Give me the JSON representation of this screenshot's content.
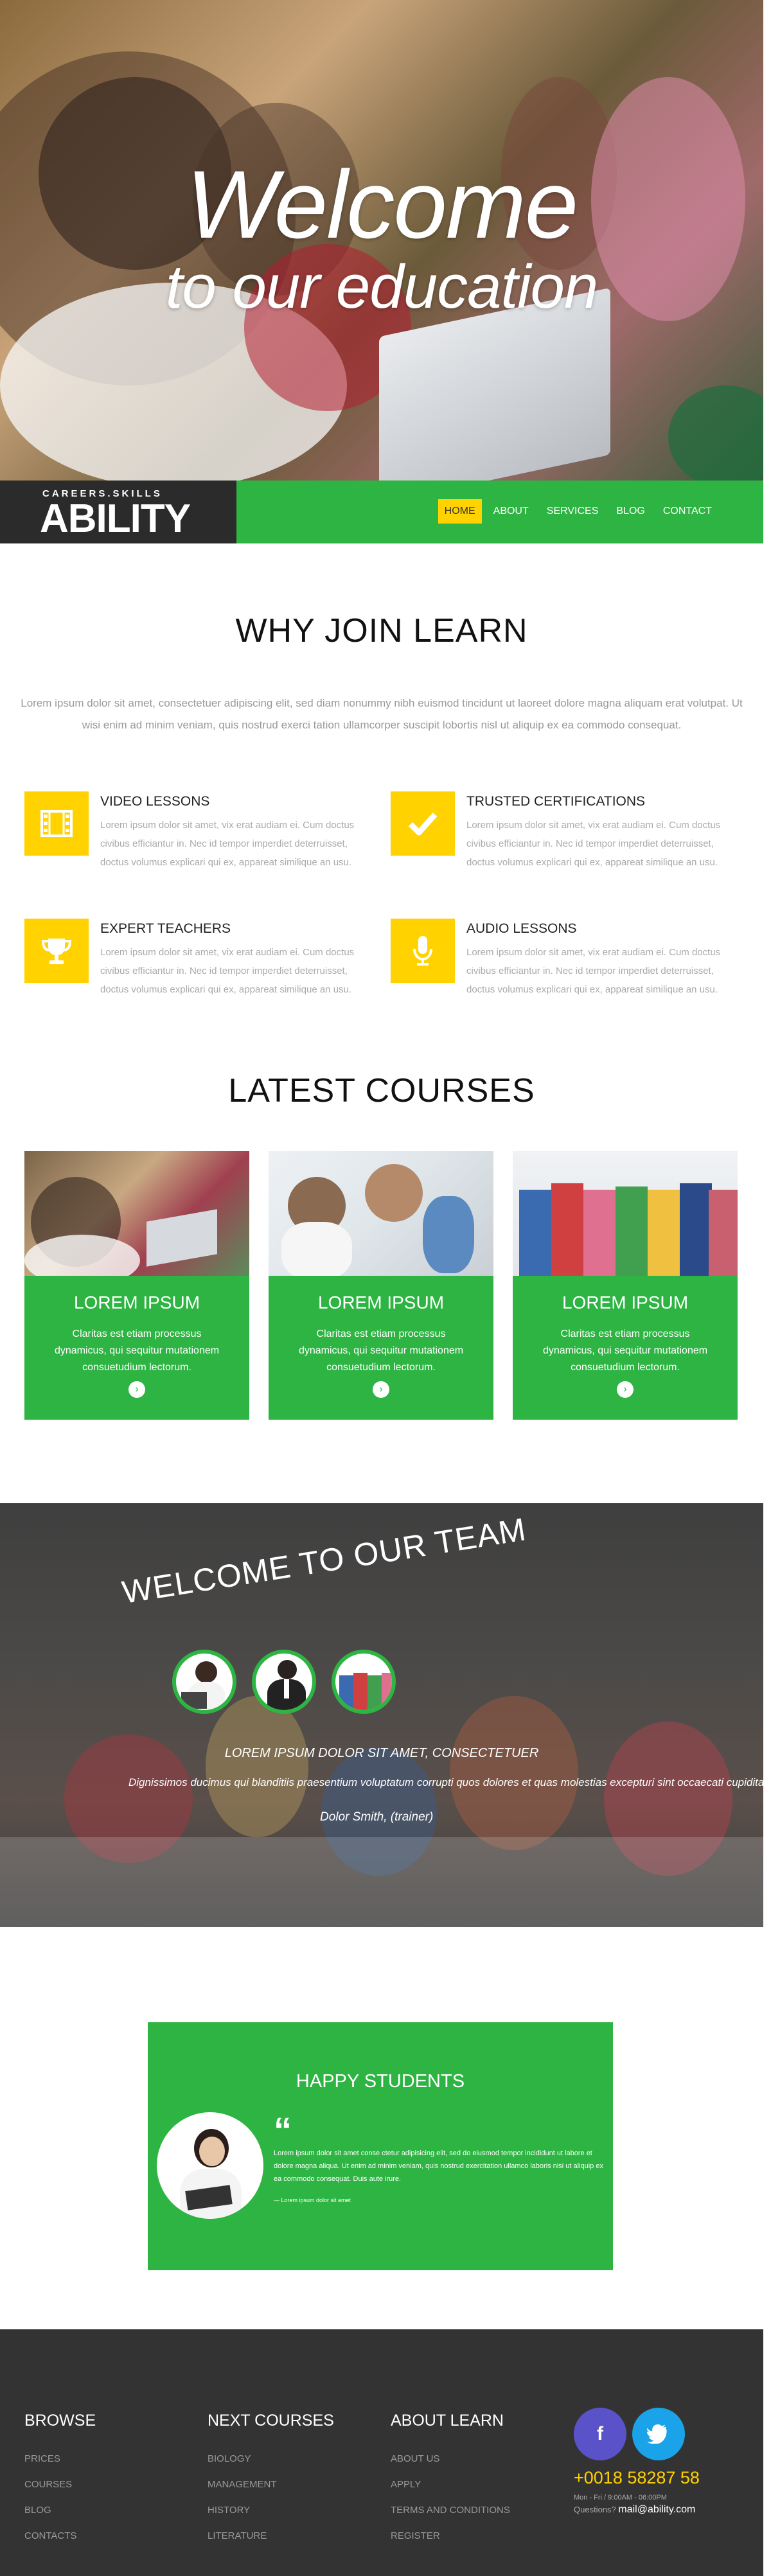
{
  "hero": {
    "title_line1": "Welcome",
    "title_line2": "to our education"
  },
  "logo": {
    "tagline": "CAREERS.SKILLS",
    "name": "ABILITY"
  },
  "nav": {
    "items": [
      {
        "label": "HOME",
        "active": true
      },
      {
        "label": "ABOUT",
        "active": false
      },
      {
        "label": "SERVICES",
        "active": false
      },
      {
        "label": "BLOG",
        "active": false
      },
      {
        "label": "CONTACT",
        "active": false
      }
    ]
  },
  "why_join": {
    "title": "WHY JOIN LEARN",
    "intro": "Lorem ipsum dolor sit amet, consectetuer adipiscing elit, sed diam nonummy nibh euismod tincidunt ut laoreet dolore magna aliquam erat volutpat. Ut wisi enim ad minim veniam, quis nostrud exerci tation ullamcorper suscipit lobortis nisl ut aliquip ex ea commodo consequat.",
    "features": [
      {
        "icon": "film-icon",
        "title": "VIDEO LESSONS",
        "text": "Lorem ipsum dolor sit amet, vix erat audiam ei. Cum doctus civibus efficiantur in. Nec id tempor imperdiet deterruisset, doctus volumus explicari qui ex, appareat similique an usu."
      },
      {
        "icon": "check-icon",
        "title": "TRUSTED CERTIFICATIONS",
        "text": "Lorem ipsum dolor sit amet, vix erat audiam ei. Cum doctus civibus efficiantur in. Nec id tempor imperdiet deterruisset, doctus volumus explicari qui ex, appareat similique an usu."
      },
      {
        "icon": "trophy-icon",
        "title": "EXPERT TEACHERS",
        "text": "Lorem ipsum dolor sit amet, vix erat audiam ei. Cum doctus civibus efficiantur in. Nec id tempor imperdiet deterruisset, doctus volumus explicari qui ex, appareat similique an usu."
      },
      {
        "icon": "microphone-icon",
        "title": "AUDIO LESSONS",
        "text": "Lorem ipsum dolor sit amet, vix erat audiam ei. Cum doctus civibus efficiantur in. Nec id tempor imperdiet deterruisset, doctus volumus explicari qui ex, appareat similique an usu."
      }
    ]
  },
  "courses": {
    "title": "LATEST COURSES",
    "items": [
      {
        "title": "LOREM IPSUM",
        "text": "Claritas est etiam processus dynamicus, qui sequitur mutationem consuetudium lectorum."
      },
      {
        "title": "LOREM IPSUM",
        "text": "Claritas est etiam processus dynamicus, qui sequitur mutationem consuetudium lectorum."
      },
      {
        "title": "LOREM IPSUM",
        "text": "Claritas est etiam processus dynamicus, qui sequitur mutationem consuetudium lectorum."
      }
    ]
  },
  "team": {
    "title": "WELCOME TO OUR TEAM",
    "quote_head": "LOREM IPSUM DOLOR SIT AMET, CONSECTETUER",
    "quote": "Dignissimos ducimus qui blanditiis praesentium voluptatum corrupti quos dolores et quas molestias excepturi sint occaecati cupiditate non provident, similique sunt in culpa qui officia deserunt mollitia animi id est.",
    "author": "Dolor Smith, (trainer)"
  },
  "happy": {
    "title": "HAPPY STUDENTS",
    "text": "Lorem ipsum dolor sit amet conse ctetur adipisicing elit, sed do eiusmod tempor incididunt ut labore et dolore magna aliqua. Ut enim ad minim veniam, quis nostrud exercitation ullamco laboris nisi ut aliquip ex ea commodo consequat. Duis aute irure.",
    "cite": "— Lorem ipsum dolor sit amet"
  },
  "footer": {
    "browse": {
      "title": "BROWSE",
      "links": [
        "PRICES",
        "COURSES",
        "BLOG",
        "CONTACTS"
      ]
    },
    "next": {
      "title": "NEXT COURSES",
      "links": [
        "BIOLOGY",
        "MANAGEMENT",
        "HISTORY",
        "LITERATURE"
      ]
    },
    "about": {
      "title": "ABOUT LEARN",
      "links": [
        "ABOUT US",
        "APPLY",
        "TERMS AND CONDITIONS",
        "REGISTER"
      ]
    },
    "phone": "+0018 58287 58",
    "hours": "Mon - Fri / 9:00AM - 06:00PM",
    "questions_label": "Questions?",
    "email": "mail@ability.com"
  },
  "colors": {
    "green": "#2db442",
    "yellow": "#ffd200",
    "dark": "#333333"
  }
}
